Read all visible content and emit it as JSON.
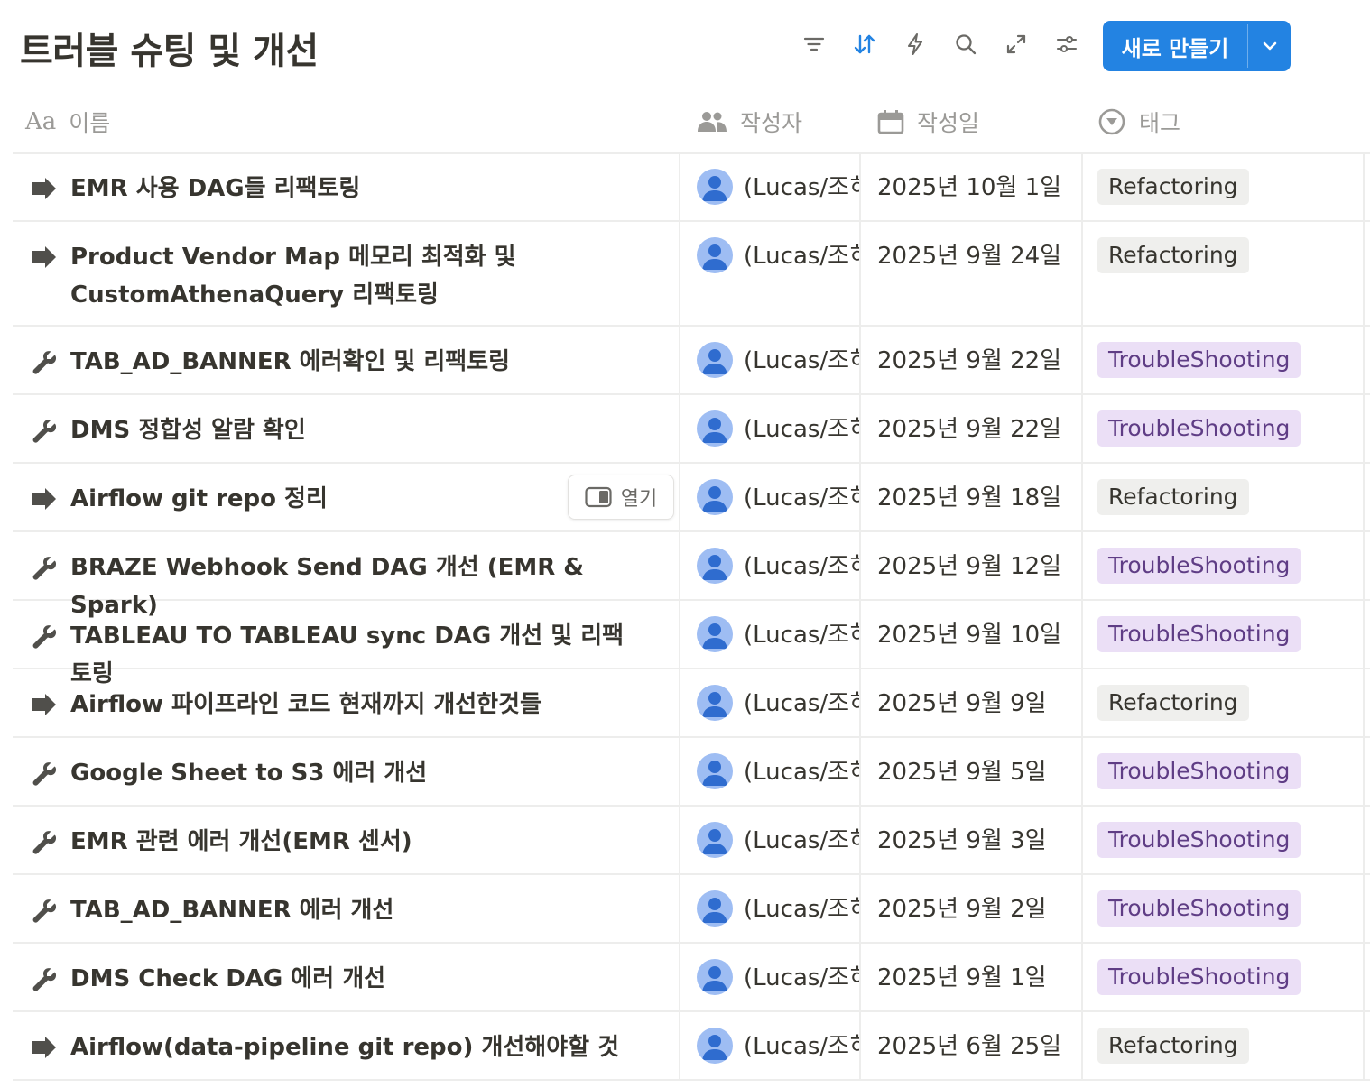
{
  "page": {
    "title": "트러블 슈팅 및 개선"
  },
  "toolbar": {
    "icons": [
      "filter-icon",
      "sort-icon",
      "automation-icon",
      "search-icon",
      "expand-icon",
      "settings-icon"
    ],
    "new_label": "새로 만들기",
    "accent": "#2383e2"
  },
  "columns": {
    "name": {
      "icon": "text-icon",
      "icon_text": "Aa",
      "label": "이름"
    },
    "author": {
      "icon": "people-icon",
      "label": "작성자"
    },
    "date": {
      "icon": "calendar-icon",
      "label": "작성일"
    },
    "tag": {
      "icon": "select-icon",
      "label": "태그"
    }
  },
  "hover_open_label": "열기",
  "tag_colors": {
    "Refactoring": {
      "bg": "#efefed",
      "fg": "#37352f"
    },
    "TroubleShooting": {
      "bg": "#ebdff6",
      "fg": "#5f3d85"
    }
  },
  "rows": [
    {
      "icon": "arrow-right-icon",
      "title": "EMR 사용 DAG들 리팩토링",
      "author": "(Lucas/조히",
      "date": "2025년 10월 1일",
      "tag": "Refactoring"
    },
    {
      "icon": "arrow-right-icon",
      "title": "Product Vendor Map 메모리 최적화 및 CustomAthenaQuery 리팩토링",
      "author": "(Lucas/조히",
      "date": "2025년 9월 24일",
      "tag": "Refactoring"
    },
    {
      "icon": "wrench-icon",
      "title": "TAB_AD_BANNER 에러확인 및 리팩토링",
      "author": "(Lucas/조히",
      "date": "2025년 9월 22일",
      "tag": "TroubleShooting"
    },
    {
      "icon": "wrench-icon",
      "title": "DMS 정합성 알람 확인",
      "author": "(Lucas/조히",
      "date": "2025년 9월 22일",
      "tag": "TroubleShooting"
    },
    {
      "icon": "arrow-right-icon",
      "title": "Airflow git repo 정리",
      "author": "(Lucas/조히",
      "date": "2025년 9월 18일",
      "tag": "Refactoring",
      "hovered": true
    },
    {
      "icon": "wrench-icon",
      "title": "BRAZE Webhook Send DAG 개선 (EMR & Spark)",
      "author": "(Lucas/조히",
      "date": "2025년 9월 12일",
      "tag": "TroubleShooting"
    },
    {
      "icon": "wrench-icon",
      "title": "TABLEAU TO TABLEAU sync DAG 개선 및 리팩토링",
      "author": "(Lucas/조히",
      "date": "2025년 9월 10일",
      "tag": "TroubleShooting"
    },
    {
      "icon": "arrow-right-icon",
      "title": "Airflow 파이프라인 코드 현재까지 개선한것들",
      "author": "(Lucas/조히",
      "date": "2025년 9월 9일",
      "tag": "Refactoring"
    },
    {
      "icon": "wrench-icon",
      "title": "Google Sheet to S3 에러 개선",
      "author": "(Lucas/조히",
      "date": "2025년 9월 5일",
      "tag": "TroubleShooting"
    },
    {
      "icon": "wrench-icon",
      "title": "EMR 관련 에러 개선(EMR 센서)",
      "author": "(Lucas/조히",
      "date": "2025년 9월 3일",
      "tag": "TroubleShooting"
    },
    {
      "icon": "wrench-icon",
      "title": "TAB_AD_BANNER 에러 개선",
      "author": "(Lucas/조히",
      "date": "2025년 9월 2일",
      "tag": "TroubleShooting"
    },
    {
      "icon": "wrench-icon",
      "title": "DMS Check DAG 에러 개선",
      "author": "(Lucas/조히",
      "date": "2025년 9월 1일",
      "tag": "TroubleShooting"
    },
    {
      "icon": "arrow-right-icon",
      "title": "Airflow(data-pipeline git repo) 개선해야할 것",
      "author": "(Lucas/조히",
      "date": "2025년 6월 25일",
      "tag": "Refactoring"
    }
  ]
}
